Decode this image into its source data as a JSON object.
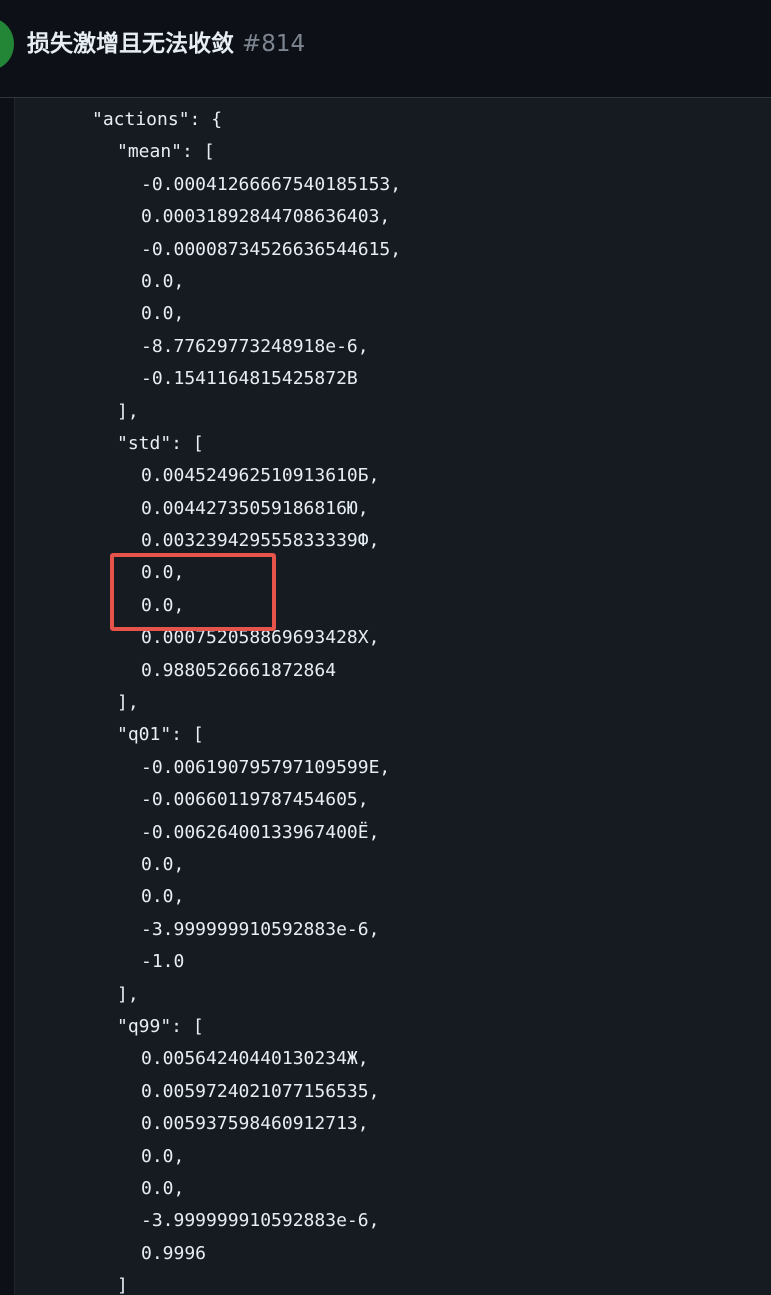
{
  "header": {
    "title": "损失激增且无法收敛",
    "number": "#814"
  },
  "annotation": {
    "color": "#e5534b"
  },
  "code": {
    "lines": [
      "\"actions\": {",
      "\"mean\": [",
      "-0.00041266667540185153,",
      "0.0003189284470863640З,",
      "-0.00008734526636544615,",
      "0.0,",
      "0.0,",
      "-8.77629773248918e-6,",
      "-0.1541164815425872В",
      "],",
      "\"std\": [",
      "0.004524962510913610Б,",
      "0.00442735059186816Ю,",
      "0.003239429555833339Ф,",
      "0.0,",
      "0.0,",
      "0.000752058869693428Х,",
      "0.9880526661872864",
      "],",
      "\"q01\": [",
      "-0.006190795797109599Е,",
      "-0.00660119787454605,",
      "-0.00626400133967400Ё,",
      "0.0,",
      "0.0,",
      "-3.999999910592883e-6,",
      "-1.0",
      "],",
      "\"q99\": [",
      "0.00564240440130234Ж,",
      "0.00597240210771565З5,",
      "0.005937598460912713,",
      "0.0,",
      "0.0,",
      "-3.999999910592883e-6,",
      "0.9996",
      "]"
    ]
  }
}
